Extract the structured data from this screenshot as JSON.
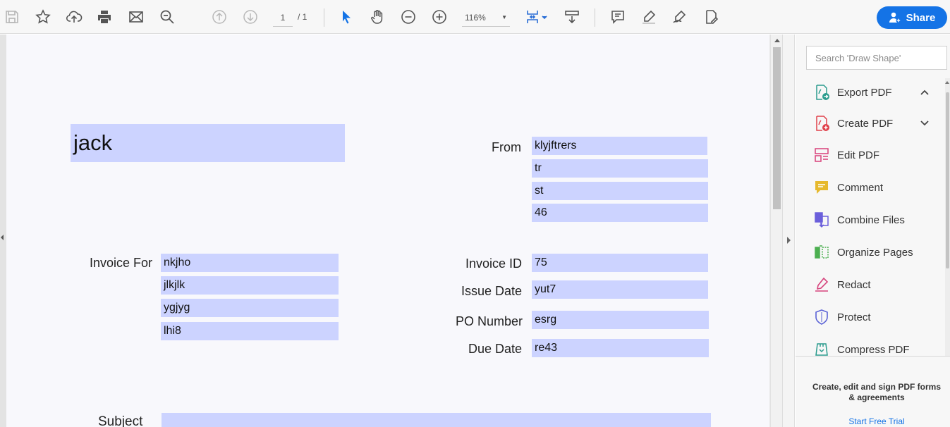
{
  "toolbar": {
    "page_current": "1",
    "page_total": "/ 1",
    "zoom": "116%",
    "share_label": "Share",
    "icons": [
      "save-icon",
      "bookmark-star-icon",
      "upload-cloud-icon",
      "print-icon",
      "email-icon",
      "find-zoom-icon",
      "previous-page-icon",
      "next-page-icon",
      "select-cursor-icon",
      "hand-tool-icon",
      "zoom-out-icon",
      "zoom-in-icon",
      "fit-page-icon",
      "scroll-mode-icon",
      "comment-icon",
      "highlight-pen-icon",
      "sign-icon",
      "fill-edit-icon"
    ]
  },
  "document": {
    "header_name": "jack",
    "from_label": "From",
    "from_lines": [
      "klyjftrers",
      "tr",
      "st",
      "46"
    ],
    "invoice_for_label": "Invoice For",
    "invoice_for_lines": [
      "nkjho",
      "jlkjlk",
      "ygjyg",
      "lhi8"
    ],
    "invoice_id_label": "Invoice ID",
    "invoice_id": "75",
    "issue_date_label": "Issue Date",
    "issue_date": "yut7",
    "po_number_label": "PO Number",
    "po_number": "esrg",
    "due_date_label": "Due Date",
    "due_date": "re43",
    "subject_label": "Subject",
    "subject": ""
  },
  "pane": {
    "search_placeholder": "Search 'Draw Shape'",
    "tools": [
      {
        "label": "Export PDF",
        "icon": "export-pdf-icon",
        "color": "#2b9c8e"
      },
      {
        "label": "Create PDF",
        "icon": "create-pdf-icon",
        "color": "#e0404a"
      },
      {
        "label": "Edit PDF",
        "icon": "edit-pdf-icon",
        "color": "#d9407a"
      },
      {
        "label": "Comment",
        "icon": "comment-tool-icon",
        "color": "#e6b92d"
      },
      {
        "label": "Combine Files",
        "icon": "combine-files-icon",
        "color": "#6b5fdb"
      },
      {
        "label": "Organize Pages",
        "icon": "organize-pages-icon",
        "color": "#4caf50"
      },
      {
        "label": "Redact",
        "icon": "redact-icon",
        "color": "#d6447d"
      },
      {
        "label": "Protect",
        "icon": "protect-shield-icon",
        "color": "#5b63d6"
      },
      {
        "label": "Compress PDF",
        "icon": "compress-pdf-icon",
        "color": "#2b9c8e"
      }
    ],
    "promo_text": "Create, edit and sign PDF forms & agreements",
    "promo_link": "Start Free Trial"
  },
  "colors": {
    "accent": "#1473e6",
    "form_field": "#ccd3ff",
    "page_bg": "#f8f8fc"
  }
}
